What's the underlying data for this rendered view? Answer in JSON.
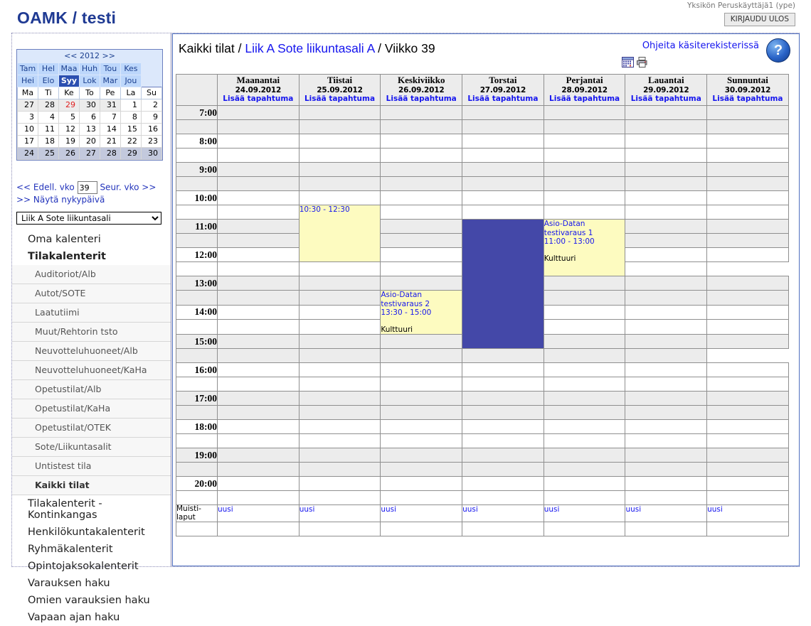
{
  "app": {
    "title": "OAMK / testi",
    "user": "Yksikön Peruskäyttäjä1 (ype)",
    "logout_label": "KIRJAUDU ULOS"
  },
  "minicalendar": {
    "year_label": "<< 2012 >>",
    "months": [
      "Tam",
      "Hel",
      "Maa",
      "Huh",
      "Tou",
      "Kes",
      "Hei",
      "Elo",
      "Syy",
      "Lok",
      "Mar",
      "Jou"
    ],
    "selected_month": "Syy",
    "weekday_headers": [
      "Ma",
      "Ti",
      "Ke",
      "To",
      "Pe",
      "La",
      "Su"
    ],
    "weeks": [
      [
        "27",
        "28",
        "29",
        "30",
        "31",
        "1",
        "2"
      ],
      [
        "3",
        "4",
        "5",
        "6",
        "7",
        "8",
        "9"
      ],
      [
        "10",
        "11",
        "12",
        "13",
        "14",
        "15",
        "16"
      ],
      [
        "17",
        "18",
        "19",
        "20",
        "21",
        "22",
        "23"
      ],
      [
        "24",
        "25",
        "26",
        "27",
        "28",
        "29",
        "30"
      ]
    ],
    "today": "29",
    "prev_week_label": "<< Edell. vko",
    "next_week_label": "Seur. vko >>",
    "week_value": "39",
    "today_link_label": ">> Näytä nykypäivä"
  },
  "room_select": {
    "value": "Liik A Sote liikuntasali"
  },
  "sidebar": {
    "top_items": [
      {
        "label": "Oma kalenteri",
        "bold": false
      },
      {
        "label": "Tilakalenterit",
        "bold": true
      }
    ],
    "sub_items": [
      {
        "label": "Auditoriot/Alb",
        "active": false
      },
      {
        "label": "Autot/SOTE",
        "active": false
      },
      {
        "label": "Laatutiimi",
        "active": false
      },
      {
        "label": "Muut/Rehtorin tsto",
        "active": false
      },
      {
        "label": "Neuvotteluhuoneet/Alb",
        "active": false
      },
      {
        "label": "Neuvotteluhuoneet/KaHa",
        "active": false
      },
      {
        "label": "Opetustilat/Alb",
        "active": false
      },
      {
        "label": "Opetustilat/KaHa",
        "active": false
      },
      {
        "label": "Opetustilat/OTEK",
        "active": false
      },
      {
        "label": "Sote/Liikuntasalit",
        "active": false
      },
      {
        "label": "Untistest tila",
        "active": false
      },
      {
        "label": "Kaikki tilat",
        "active": true
      }
    ],
    "bottom_items": [
      {
        "label": "Tilakalenterit - Kontinkangas"
      },
      {
        "label": "Henkilökuntakalenterit"
      },
      {
        "label": "Ryhmäkalenterit"
      },
      {
        "label": "Opintojaksokalenterit"
      },
      {
        "label": "Varauksen haku"
      },
      {
        "label": "Omien varauksien haku"
      },
      {
        "label": "Vapaan ajan haku"
      }
    ]
  },
  "content_header": {
    "crumb_root": "Kaikki tilat",
    "crumb_sep1": " / ",
    "crumb_room": "Liik A Sote liikuntasali A",
    "crumb_sep2": " / ",
    "crumb_week": "Viikko 39",
    "help_link": "Ohjeita käsiterekisterissä",
    "help_badge": "?",
    "print_select_value": "-- Tulostettava versio --"
  },
  "week_grid": {
    "add_event_label": "Lisää tapahtuma",
    "notes_label_line1": "Muisti-",
    "notes_label_line2": "laput",
    "notes_new_label": "uusi",
    "days": [
      {
        "name": "Maanantai",
        "date": "24.09.2012"
      },
      {
        "name": "Tiistai",
        "date": "25.09.2012"
      },
      {
        "name": "Keskiviikko",
        "date": "26.09.2012"
      },
      {
        "name": "Torstai",
        "date": "27.09.2012"
      },
      {
        "name": "Perjantai",
        "date": "28.09.2012"
      },
      {
        "name": "Lauantai",
        "date": "29.09.2012"
      },
      {
        "name": "Sunnuntai",
        "date": "30.09.2012"
      }
    ],
    "hours": [
      "7:00",
      "8:00",
      "9:00",
      "10:00",
      "11:00",
      "12:00",
      "13:00",
      "14:00",
      "15:00",
      "16:00",
      "17:00",
      "18:00",
      "19:00",
      "20:00"
    ],
    "events": [
      {
        "day": "Tiistai",
        "day_index": 1,
        "start": "10:30",
        "end": "12:30",
        "title_line1": "10:30 - 12:30",
        "title_line2": "",
        "time_text": "",
        "note": "",
        "color": "#fdfbc0",
        "kind": "yellow"
      },
      {
        "day": "Perjantai",
        "day_index": 4,
        "start": "11:00",
        "end": "13:00",
        "title_line1": "Asio-Datan",
        "title_line2": "testivaraus 1",
        "time_text": "11:00 - 13:00",
        "note": "Kulttuuri",
        "color": "#fdfbc0",
        "kind": "yellow"
      },
      {
        "day": "Keskiviikko",
        "day_index": 2,
        "start": "13:30",
        "end": "15:00",
        "title_line1": "Asio-Datan",
        "title_line2": "testivaraus 2",
        "time_text": "13:30 - 15:00",
        "note": "Kulttuuri",
        "color": "#fdfbc0",
        "kind": "yellow"
      },
      {
        "day": "Torstai",
        "day_index": 3,
        "start": "11:00",
        "end": "15:30",
        "title_line1": "",
        "title_line2": "",
        "time_text": "",
        "note": "",
        "color": "#4448a8",
        "kind": "blue"
      }
    ]
  },
  "colors": {
    "brand": "#1f3a93",
    "link": "#1515ee",
    "event_yellow": "#fdfbc0",
    "event_blue": "#4448a8",
    "header_gray": "#ececec",
    "minical_blue": "#bdd7fb"
  }
}
